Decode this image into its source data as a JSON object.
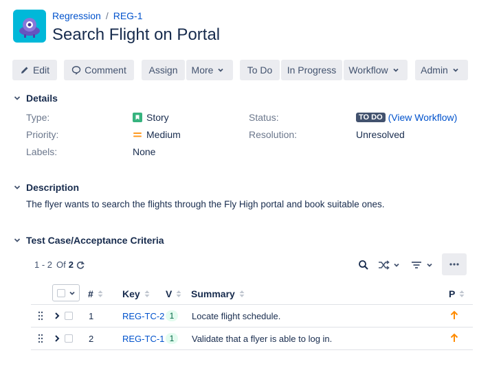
{
  "breadcrumb": {
    "project": "Regression",
    "issue_key": "REG-1"
  },
  "issue": {
    "title": "Search Flight on Portal"
  },
  "toolbar": {
    "edit": "Edit",
    "comment": "Comment",
    "assign": "Assign",
    "more": "More",
    "todo": "To Do",
    "in_progress": "In Progress",
    "workflow": "Workflow",
    "admin": "Admin"
  },
  "details": {
    "heading": "Details",
    "type_label": "Type:",
    "type_value": "Story",
    "priority_label": "Priority:",
    "priority_value": "Medium",
    "labels_label": "Labels:",
    "labels_value": "None",
    "status_label": "Status:",
    "status_value": "TO DO",
    "view_workflow": "(View Workflow)",
    "resolution_label": "Resolution:",
    "resolution_value": "Unresolved"
  },
  "description": {
    "heading": "Description",
    "text": "The flyer wants to search the flights through the Fly High portal and book suitable ones."
  },
  "tests": {
    "heading": "Test Case/Acceptance Criteria",
    "pager_range": "1 - 2",
    "pager_of": "Of",
    "pager_total": "2",
    "columns": {
      "num": "#",
      "key": "Key",
      "v": "V",
      "summary": "Summary",
      "p": "P"
    },
    "rows": [
      {
        "num": "1",
        "key": "REG-TC-2",
        "v": "1",
        "summary": "Locate flight schedule."
      },
      {
        "num": "2",
        "key": "REG-TC-1",
        "v": "1",
        "summary": "Validate that a flyer is able to log in."
      }
    ]
  },
  "colors": {
    "accent": "#0052cc",
    "story": "#36b37e",
    "priority": "#ff991f",
    "arrow": "#ff8b00",
    "lozenge": "#42526e"
  }
}
